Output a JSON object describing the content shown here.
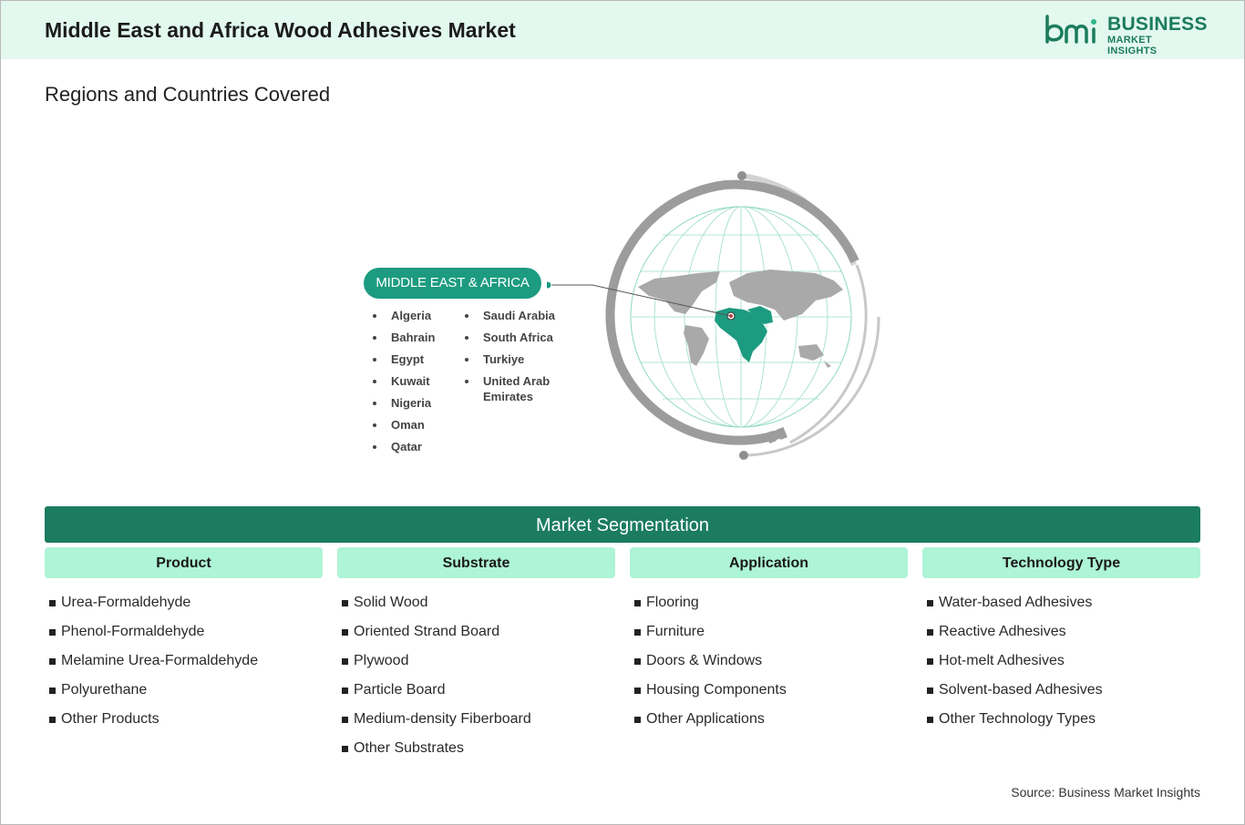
{
  "header": {
    "title": "Middle East and Africa Wood Adhesives Market",
    "logo_line1": "BUSINESS",
    "logo_line2": "MARKET INSIGHTS",
    "logo_mark": "bmi",
    "background": "#e3f8ef",
    "brand_color": "#1b7c5c"
  },
  "regions": {
    "section_title": "Regions and Countries Covered",
    "region_label": "MIDDLE EAST & AFRICA",
    "accent": "#1c9b80",
    "countries_left": [
      "Algeria",
      "Bahrain",
      "Egypt",
      "Kuwait",
      "Nigeria",
      "Oman",
      "Qatar"
    ],
    "countries_right": [
      "Saudi Arabia",
      "South Africa",
      "Turkiye",
      "United Arab Emirates"
    ],
    "globe_icon": "world-globe-icon"
  },
  "segmentation": {
    "title": "Market Segmentation",
    "band_color": "#1b7c5f",
    "header_color": "#aef4d6",
    "columns": [
      {
        "heading": "Product",
        "items": [
          "Urea-Formaldehyde",
          "Phenol-Formaldehyde",
          "Melamine Urea-Formaldehyde",
          "Polyurethane",
          "Other Products"
        ]
      },
      {
        "heading": "Substrate",
        "items": [
          "Solid Wood",
          "Oriented Strand Board",
          "Plywood",
          "Particle Board",
          "Medium-density Fiberboard",
          "Other Substrates"
        ]
      },
      {
        "heading": "Application",
        "items": [
          "Flooring",
          "Furniture",
          "Doors & Windows",
          "Housing Components",
          "Other Applications"
        ]
      },
      {
        "heading": "Technology Type",
        "items": [
          "Water-based Adhesives",
          "Reactive Adhesives",
          "Hot-melt Adhesives",
          "Solvent-based Adhesives",
          "Other Technology Types"
        ]
      }
    ]
  },
  "footer": {
    "source": "Source: Business Market Insights"
  }
}
